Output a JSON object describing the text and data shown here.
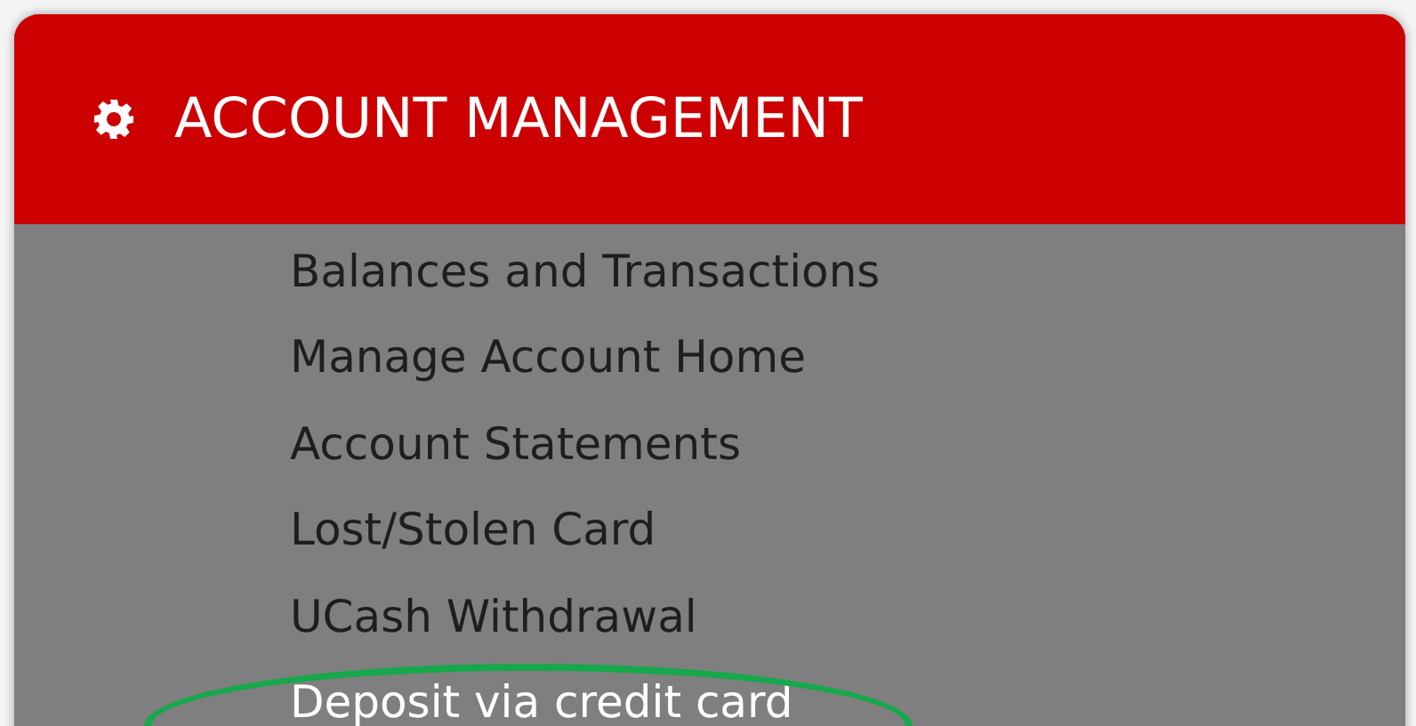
{
  "panel": {
    "title": "ACCOUNT MANAGEMENT",
    "items": [
      {
        "label": "Balances and Transactions",
        "selected": false,
        "circled": false
      },
      {
        "label": "Manage Account Home",
        "selected": false,
        "circled": false
      },
      {
        "label": "Account Statements",
        "selected": false,
        "circled": false
      },
      {
        "label": "Lost/Stolen Card",
        "selected": false,
        "circled": false
      },
      {
        "label": "UCash Withdrawal",
        "selected": false,
        "circled": false
      },
      {
        "label": "Deposit via credit card",
        "selected": true,
        "circled": true
      }
    ]
  }
}
